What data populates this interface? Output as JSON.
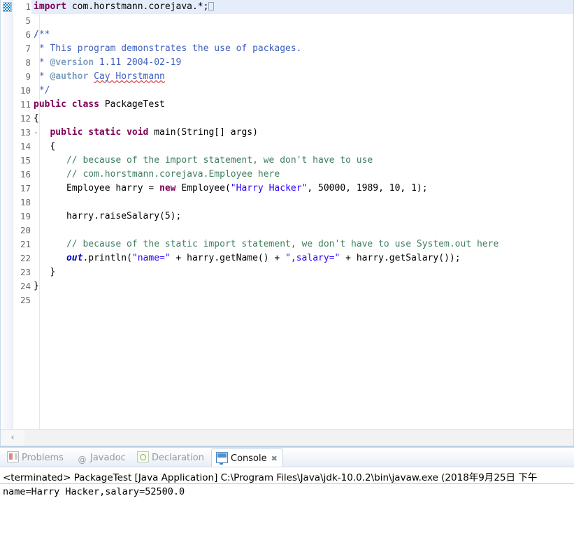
{
  "editor": {
    "current_line": 1,
    "current_line_color": "#e4edf9",
    "caret_placeholder": "",
    "lines": [
      {
        "num": "1",
        "fold": "+",
        "current": true,
        "indent": 0
      },
      {
        "num": "5",
        "fold": "",
        "current": false,
        "indent": 0
      },
      {
        "num": "6",
        "fold": "-",
        "current": false,
        "indent": 0
      },
      {
        "num": "7",
        "fold": "",
        "current": false,
        "indent": 0
      },
      {
        "num": "8",
        "fold": "",
        "current": false,
        "indent": 0
      },
      {
        "num": "9",
        "fold": "",
        "current": false,
        "indent": 0
      },
      {
        "num": "10",
        "fold": "",
        "current": false,
        "indent": 0
      },
      {
        "num": "11",
        "fold": "",
        "current": false,
        "indent": 0
      },
      {
        "num": "12",
        "fold": "",
        "current": false,
        "indent": 0
      },
      {
        "num": "13",
        "fold": "-",
        "current": false,
        "indent": 0
      },
      {
        "num": "14",
        "fold": "",
        "current": false,
        "indent": 0
      },
      {
        "num": "15",
        "fold": "",
        "current": false,
        "indent": 0
      },
      {
        "num": "16",
        "fold": "",
        "current": false,
        "indent": 0
      },
      {
        "num": "17",
        "fold": "",
        "current": false,
        "indent": 0
      },
      {
        "num": "18",
        "fold": "",
        "current": false,
        "indent": 0
      },
      {
        "num": "19",
        "fold": "",
        "current": false,
        "indent": 0
      },
      {
        "num": "20",
        "fold": "",
        "current": false,
        "indent": 0
      },
      {
        "num": "21",
        "fold": "",
        "current": false,
        "indent": 0
      },
      {
        "num": "22",
        "fold": "",
        "current": false,
        "indent": 0
      },
      {
        "num": "23",
        "fold": "",
        "current": false,
        "indent": 0
      },
      {
        "num": "24",
        "fold": "",
        "current": false,
        "indent": 0
      },
      {
        "num": "25",
        "fold": "",
        "current": false,
        "indent": 0
      }
    ],
    "code_text": {
      "l1": "import com.horstmann.corejava.*;",
      "l5": "",
      "l6": "/**",
      "l7": " * This program demonstrates the use of packages.",
      "l8": " * @version 1.11 2004-02-19",
      "l9": " * @author Cay Horstmann",
      "l10": " */",
      "l11": "public class PackageTest",
      "l12": "{",
      "l13": "   public static void main(String[] args)",
      "l14": "   {",
      "l15": "      // because of the import statement, we don't have to use",
      "l16": "      // com.horstmann.corejava.Employee here",
      "l17": "      Employee harry = new Employee(\"Harry Hacker\", 50000, 1989, 10, 1);",
      "l18": "",
      "l19": "      harry.raiseSalary(5);",
      "l20": "",
      "l21": "      // because of the static import statement, we don't have to use System.out here",
      "l22": "      out.println(\"name=\" + harry.getName() + \",salary=\" + harry.getSalary());",
      "l23": "   }",
      "l24": "}",
      "l25": ""
    },
    "tokens": {
      "kw_import": "import",
      "pkg_import": " com.horstmann.corejava.*;",
      "jdoc_open": "/**",
      "jdoc_star": " * ",
      "jdoc_line7": "This program demonstrates the use of packages.",
      "jdoc_tag_version": "@version",
      "jdoc_version_value": " 1.11 2004-02-19",
      "jdoc_tag_author": "@author",
      "jdoc_author_value": "Cay Horstmann",
      "jdoc_close": " */",
      "kw_public": "public",
      "kw_class": "class",
      "type_PackageTest": " PackageTest",
      "brace_open": "{",
      "kw_static": "static",
      "kw_void": "void",
      "main_sig": " main(String[] args)",
      "cmt_15": "// because of the import statement, we don't have to use",
      "cmt_16": "// com.horstmann.corejava.Employee here",
      "l17_a": "Employee harry = ",
      "kw_new": "new",
      "l17_b": " Employee(",
      "l17_str": "\"Harry Hacker\"",
      "l17_c": ", 50000, 1989, 10, 1);",
      "l19": "harry.raiseSalary(5);",
      "cmt_21": "// because of the static import statement, we don't have to use System.out here",
      "l22_out": "out",
      "l22_a": ".println(",
      "l22_str1": "\"name=\"",
      "l22_b": " + harry.getName() + ",
      "l22_str2": "\",salary=\"",
      "l22_c": " + harry.getSalary());",
      "brace_close": "}"
    },
    "scrollbar": {
      "left_arrow": "‹"
    }
  },
  "bottom_view": {
    "tabs": [
      {
        "label": "Problems",
        "icon": "problems-icon",
        "active": false,
        "close": ""
      },
      {
        "label": "Javadoc",
        "icon": "javadoc-icon",
        "active": false,
        "close": ""
      },
      {
        "label": "Declaration",
        "icon": "declaration-icon",
        "active": false,
        "close": ""
      },
      {
        "label": "Console",
        "icon": "console-icon",
        "active": true,
        "close": "✖"
      }
    ],
    "console": {
      "terminated_line": "<terminated> PackageTest [Java Application] C:\\Program Files\\Java\\jdk-10.0.2\\bin\\javaw.exe (2018年9月25日 下午",
      "output_line": "name=Harry Hacker,salary=52500.0"
    }
  },
  "colors": {
    "keyword": "#7f0055",
    "string": "#2a00ff",
    "comment": "#3f7f5f",
    "javadoc": "#3f5fbf",
    "javadoc_tag": "#7f9fbf",
    "static_field": "#0000c0",
    "current_line_bg": "#e4edf9",
    "spellcheck_underline": "#d9534f"
  }
}
